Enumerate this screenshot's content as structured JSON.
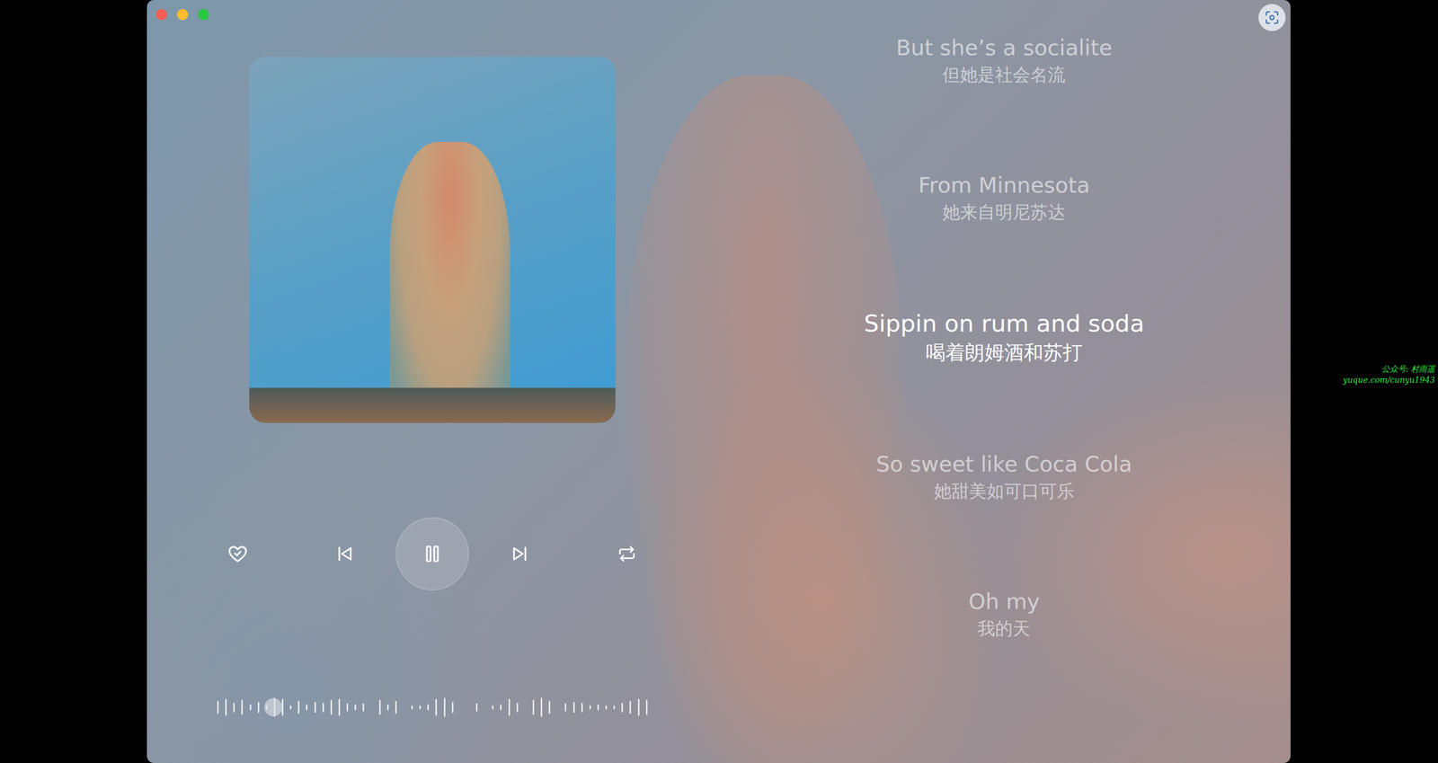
{
  "window": {
    "controls": [
      {
        "name": "close",
        "color": "#fe5f57"
      },
      {
        "name": "minimize",
        "color": "#febc2e"
      },
      {
        "name": "zoom",
        "color": "#28c840"
      }
    ]
  },
  "player": {
    "liked": false,
    "playing": true,
    "controls": [
      {
        "kind": "like"
      },
      {
        "kind": "previous"
      },
      {
        "kind": "play-pause"
      },
      {
        "kind": "next"
      },
      {
        "kind": "repeat"
      }
    ],
    "progress": {
      "level": 0.13
    },
    "waveform": [
      0.7,
      0.9,
      0.5,
      0.8,
      0.3,
      0.6,
      0.2,
      1.0,
      0.9,
      0.2,
      0.7,
      0.3,
      0.6,
      0.5,
      0.8,
      0.9,
      0.4,
      0.3,
      0.4,
      0,
      0.8,
      0.3,
      0.7,
      0,
      0.2,
      0.2,
      0.3,
      0.9,
      1.0,
      0.6,
      0,
      0,
      0.4,
      0,
      0.2,
      0.3,
      0.9,
      0.5,
      0,
      0.8,
      1.0,
      0.7,
      0,
      0.4,
      0.6,
      0.5,
      0.2,
      0.3,
      0.2,
      0.2,
      0.5,
      0.7,
      0.9,
      0.8
    ]
  },
  "lyrics": [
    {
      "text": "But she’s a socialite",
      "translation": "但她是社会名流",
      "selected": false
    },
    {
      "text": "From Minnesota",
      "translation": "她来自明尼苏达",
      "selected": false
    },
    {
      "text": "Sippin on rum and soda",
      "translation": "喝着朗姆酒和苏打",
      "selected": true
    },
    {
      "text": "So sweet like Coca Cola",
      "translation": "她甜美如可口可乐",
      "selected": false
    },
    {
      "text": "Oh my",
      "translation": "我的天",
      "selected": false
    }
  ],
  "watermark": [
    "公众号: 村雨遥",
    "yuque.com/cunyu1943"
  ]
}
